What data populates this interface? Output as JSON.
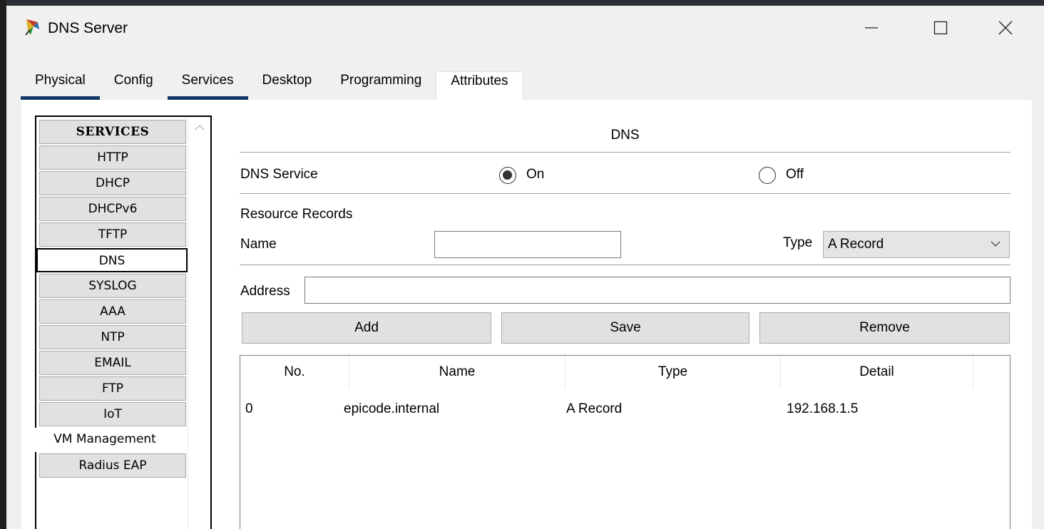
{
  "window": {
    "title": "DNS Server",
    "icon": "packet-tracer-server-icon"
  },
  "tabs": [
    {
      "label": "Physical"
    },
    {
      "label": "Config"
    },
    {
      "label": "Services"
    },
    {
      "label": "Desktop"
    },
    {
      "label": "Programming"
    },
    {
      "label": "Attributes"
    }
  ],
  "services": {
    "header": "SERVICES",
    "items": [
      "HTTP",
      "DHCP",
      "DHCPv6",
      "TFTP",
      "DNS",
      "SYSLOG",
      "AAA",
      "NTP",
      "EMAIL",
      "FTP",
      "IoT",
      "VM Management",
      "Radius EAP"
    ],
    "selected": "DNS"
  },
  "dns": {
    "heading": "DNS",
    "service_label": "DNS Service",
    "on_label": "On",
    "off_label": "Off",
    "service_state": "On",
    "resource_records_label": "Resource Records",
    "name_label": "Name",
    "name_value": "",
    "type_label": "Type",
    "type_value": "A Record",
    "address_label": "Address",
    "address_value": "",
    "buttons": {
      "add": "Add",
      "save": "Save",
      "remove": "Remove"
    },
    "table": {
      "columns": [
        "No.",
        "Name",
        "Type",
        "Detail"
      ],
      "rows": [
        {
          "no": "0",
          "name": "epicode.internal",
          "type": "A Record",
          "detail": "192.168.1.5"
        }
      ]
    }
  }
}
